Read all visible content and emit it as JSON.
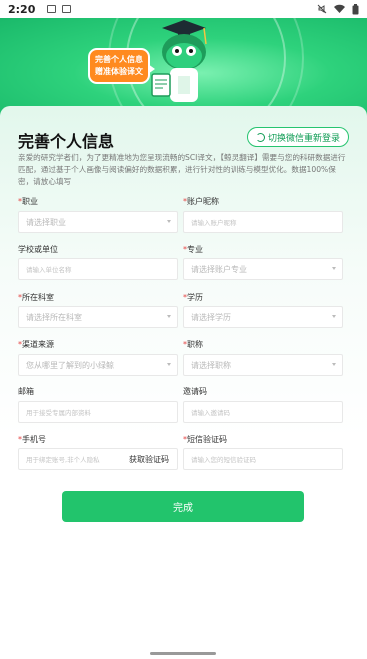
{
  "status_bar": {
    "time": "2:20"
  },
  "hero": {
    "bubble_line1": "完善个人信息",
    "bubble_line2": "赠准体验译文"
  },
  "header": {
    "title": "完善个人信息",
    "switch_label": "切换微信重新登录"
  },
  "description": "亲爱的研究学者们，为了更精准地为您呈现流畅的SCI译文，【鲸灵翻译】需要与您的科研数据进行匹配，通过基于个人画像与阅读偏好的数据积累，进行针对性的训练与模型优化。数据100%保密，请放心填写",
  "form": {
    "fields": [
      {
        "label": "职业",
        "required": true,
        "placeholder": "请选择职业",
        "type": "select"
      },
      {
        "label": "账户昵称",
        "required": true,
        "placeholder": "请输入账户昵称",
        "type": "input"
      },
      {
        "label": "学校或单位",
        "required": false,
        "placeholder": "请输入单位名称",
        "type": "input"
      },
      {
        "label": "专业",
        "required": true,
        "placeholder": "请选择账户专业",
        "type": "select"
      },
      {
        "label": "所在科室",
        "required": true,
        "placeholder": "请选择所在科室",
        "type": "select"
      },
      {
        "label": "学历",
        "required": true,
        "placeholder": "请选择学历",
        "type": "select"
      },
      {
        "label": "渠道来源",
        "required": true,
        "placeholder": "您从哪里了解到的小绿鲸",
        "type": "select"
      },
      {
        "label": "职称",
        "required": true,
        "placeholder": "请选择职称",
        "type": "select"
      },
      {
        "label": "邮箱",
        "required": false,
        "placeholder": "用于接受专属内部资料",
        "type": "input"
      },
      {
        "label": "邀请码",
        "required": false,
        "placeholder": "请输入邀请码",
        "type": "input"
      },
      {
        "label": "手机号",
        "required": true,
        "placeholder": "用于绑定账号,非个人隐私",
        "type": "input"
      },
      {
        "label": "短信验证码",
        "required": true,
        "placeholder": "请输入您的短信验证码",
        "type": "input"
      }
    ],
    "get_code_label": "获取验证码",
    "submit_label": "完成"
  },
  "colors": {
    "brand_green": "#22c46c",
    "required_red": "#e54545",
    "bubble_orange": "#ff8a1f"
  }
}
